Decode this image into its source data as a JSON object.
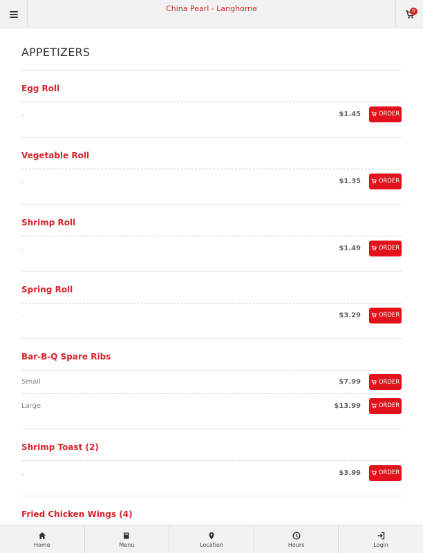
{
  "header": {
    "title": "China Pearl - Langhorne",
    "cart_count": "0"
  },
  "section": {
    "title": "APPETIZERS"
  },
  "order_label": "ORDER",
  "items": [
    {
      "name": "Egg Roll",
      "rows": [
        {
          "desc": ".",
          "price": "$1.45"
        }
      ]
    },
    {
      "name": "Vegetable Roll",
      "rows": [
        {
          "desc": ".",
          "price": "$1.35"
        }
      ]
    },
    {
      "name": "Shrimp Roll",
      "rows": [
        {
          "desc": ".",
          "price": "$1.49"
        }
      ]
    },
    {
      "name": "Spring Roll",
      "rows": [
        {
          "desc": ".",
          "price": "$3.29"
        }
      ]
    },
    {
      "name": "Bar-B-Q Spare Ribs",
      "rows": [
        {
          "desc": "Small",
          "price": "$7.99"
        },
        {
          "desc": "Large",
          "price": "$13.99"
        }
      ]
    },
    {
      "name": "Shrimp Toast (2)",
      "rows": [
        {
          "desc": ".",
          "price": "$3.99"
        }
      ]
    },
    {
      "name": "Fried Chicken Wings (4)",
      "rows": []
    }
  ],
  "nav": [
    {
      "label": "Home",
      "icon": "home-icon"
    },
    {
      "label": "Menu",
      "icon": "book-icon"
    },
    {
      "label": "Location",
      "icon": "map-pin-icon"
    },
    {
      "label": "Hours",
      "icon": "clock-icon"
    },
    {
      "label": "Login",
      "icon": "login-icon"
    }
  ],
  "colors": {
    "accent": "#d9232a",
    "order_button": "#e2121c"
  }
}
